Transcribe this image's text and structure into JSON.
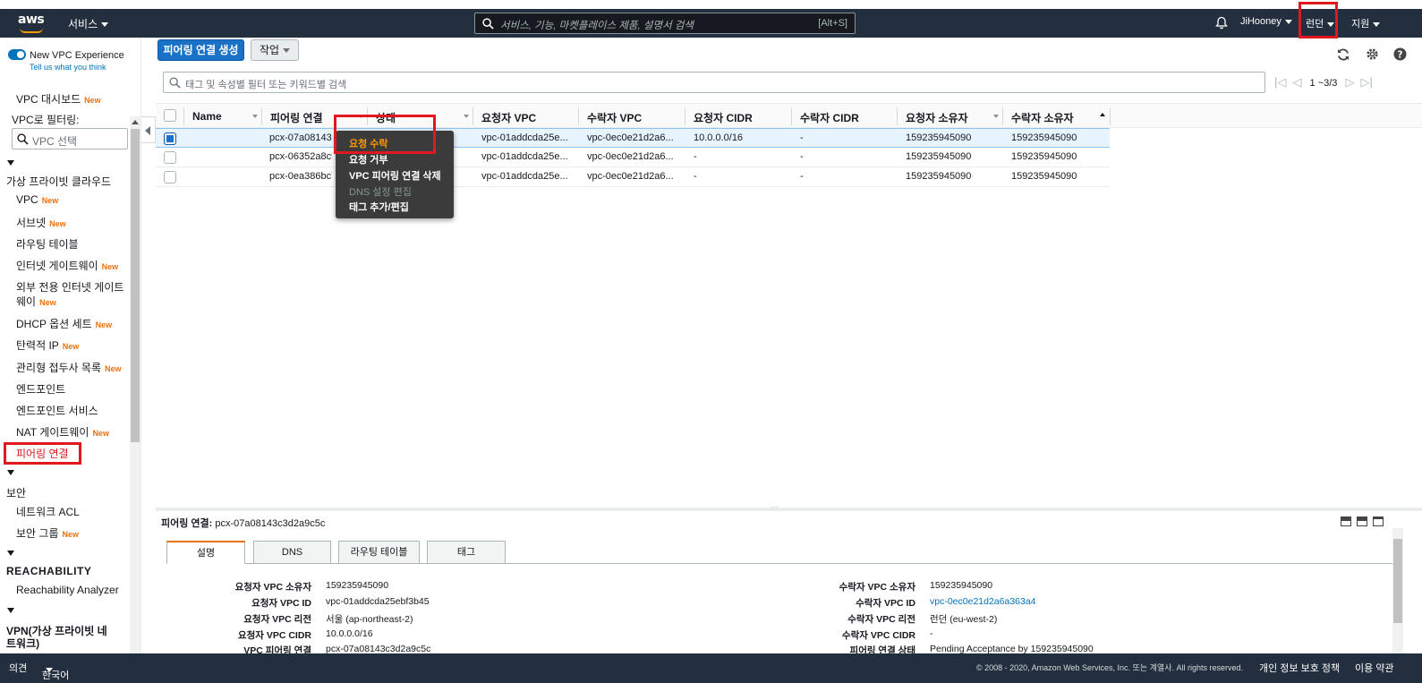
{
  "navbar": {
    "logo": "aws",
    "services": "서비스",
    "search_placeholder": "서비스, 기능, 마켓플레이스 제품, 설명서 검색",
    "search_shortcut": "[Alt+S]",
    "user": "JiHooney",
    "region": "런던",
    "support": "지원"
  },
  "sidebar": {
    "new_vpc_experience": "New VPC Experience",
    "tell_us": "Tell us what you think",
    "dashboard": "VPC 대시보드",
    "filter_label": "VPC로 필터링:",
    "filter_placeholder": "VPC 선택",
    "section_vpc": "가상 프라이빗 클라우드",
    "items": [
      {
        "label": "VPC",
        "new": "New"
      },
      {
        "label": "서브넷",
        "new": "New"
      },
      {
        "label": "라우팅 테이블",
        "new": ""
      },
      {
        "label": "인터넷 게이트웨이",
        "new": "New"
      },
      {
        "label": "외부 전용 인터넷 게이트",
        "new": ""
      },
      {
        "label": "웨이",
        "new": "New"
      },
      {
        "label": "DHCP 옵션 세트",
        "new": "New"
      },
      {
        "label": "탄력적 IP",
        "new": "New"
      },
      {
        "label": "관리형 접두사 목록",
        "new": "New"
      },
      {
        "label": "엔드포인트",
        "new": ""
      },
      {
        "label": "엔드포인트 서비스",
        "new": ""
      },
      {
        "label": "NAT 게이트웨이",
        "new": "New"
      },
      {
        "label": "피어링 연결",
        "new": ""
      }
    ],
    "section_security": "보안",
    "security_items": [
      {
        "label": "네트워크 ACL",
        "new": ""
      },
      {
        "label": "보안 그룹",
        "new": "New"
      }
    ],
    "section_reachability": "REACHABILITY",
    "reachability_item": "Reachability Analyzer",
    "section_vpn_1": "VPN(가상 프라이빗 네",
    "section_vpn_2": "트워크)",
    "new_badge": "New"
  },
  "toolbar": {
    "create_button": "피어링 연결 생성",
    "actions_button": "작업",
    "filter_placeholder": "태그 및 속성별 필터 또는 키워드별 검색",
    "pager": "1 ~3/3"
  },
  "table": {
    "columns": [
      "Name",
      "피어링 연결",
      "상태",
      "요청자 VPC",
      "수락자 VPC",
      "요청자 CIDR",
      "수락자 CIDR",
      "요청자 소유자",
      "수락자 소유자"
    ],
    "rows": [
      [
        "",
        "pcx-07a08143c",
        "",
        "vpc-01addcda25e...",
        "vpc-0ec0e21d2a6...",
        "10.0.0.0/16",
        "-",
        "159235945090",
        "159235945090"
      ],
      [
        "",
        "pcx-06352a8c9",
        "",
        "vpc-01addcda25e...",
        "vpc-0ec0e21d2a6...",
        "-",
        "-",
        "159235945090",
        "159235945090"
      ],
      [
        "",
        "pcx-0ea386bc7",
        "",
        "vpc-01addcda25e...",
        "vpc-0ec0e21d2a6...",
        "-",
        "-",
        "159235945090",
        "159235945090"
      ]
    ]
  },
  "context_menu": {
    "items": [
      "요청 수락",
      "요청 거부",
      "VPC 피어링 연결 삭제",
      "DNS 설정 편집",
      "태그 추가/편집"
    ]
  },
  "detail": {
    "title_label": "피어링 연결:",
    "title_value": "pcx-07a08143c3d2a9c5c",
    "tabs": [
      "설명",
      "DNS",
      "라우팅 테이블",
      "태그"
    ],
    "left": [
      {
        "k": "요청자 VPC 소유자",
        "v": "159235945090"
      },
      {
        "k": "요청자 VPC ID",
        "v": "vpc-01addcda25ebf3b45"
      },
      {
        "k": "요청자 VPC 리전",
        "v": "서울 (ap-northeast-2)"
      },
      {
        "k": "요청자 VPC CIDR",
        "v": "10.0.0.0/16"
      },
      {
        "k": "VPC 피어링 연결",
        "v": "pcx-07a08143c3d2a9c5c"
      }
    ],
    "right": [
      {
        "k": "수락자 VPC 소유자",
        "v": "159235945090"
      },
      {
        "k": "수락자 VPC ID",
        "v": "vpc-0ec0e21d2a6a363a4"
      },
      {
        "k": "수락자 VPC 리전",
        "v": "런던 (eu-west-2)"
      },
      {
        "k": "수락자 VPC CIDR",
        "v": "-"
      },
      {
        "k": "피어링 연결 상태",
        "v": "Pending Acceptance by 159235945090"
      }
    ]
  },
  "footer": {
    "feedback": "의견",
    "language": "한국어",
    "copyright": "© 2008 - 2020, Amazon Web Services, Inc. 또는 계열사. All rights reserved.",
    "privacy": "개인 정보 보호 정책",
    "terms": "이용 약관"
  },
  "colors": {
    "nav_bg": "#232f3e",
    "primary": "#1a72c6",
    "new_badge": "#ec7211",
    "highlight": "#e0181f"
  }
}
